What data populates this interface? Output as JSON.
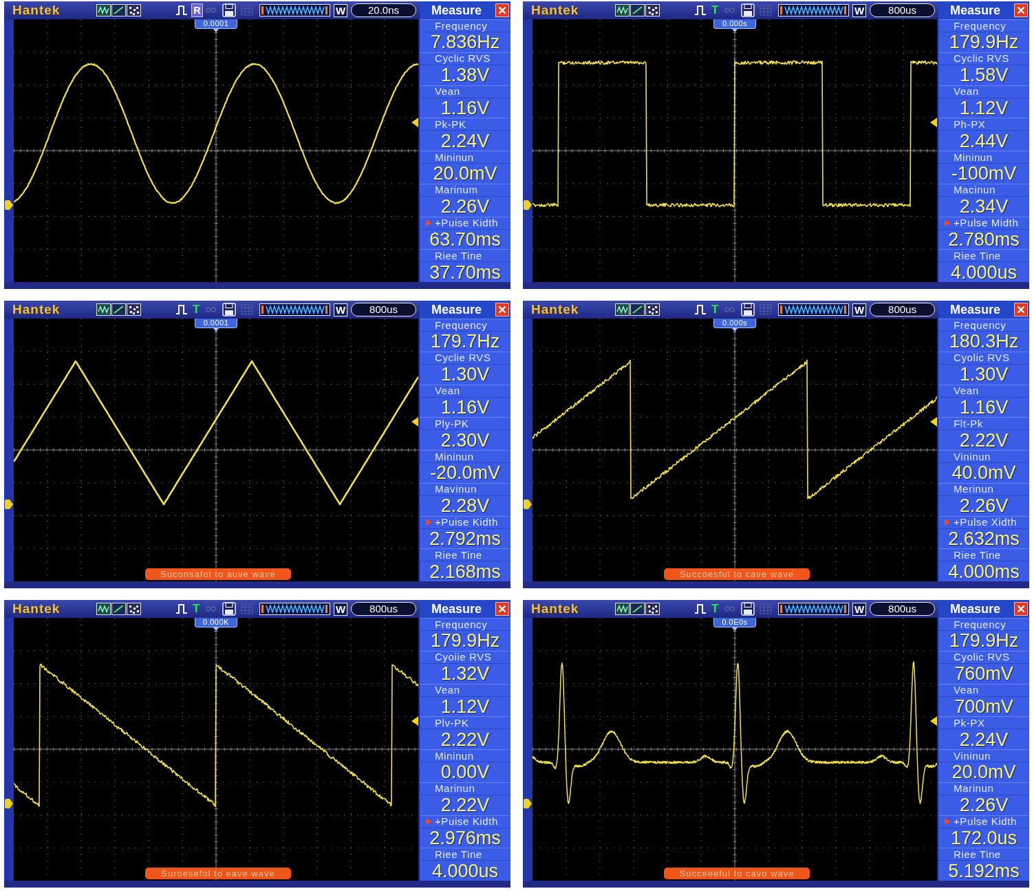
{
  "screens": [
    {
      "brand": "Hantek",
      "mode": {
        "label": "R",
        "kind": "boxed"
      },
      "memory_label": "W",
      "timebase": "20.0ns",
      "measure_title": "Measure",
      "trigger_time": "0.0001",
      "waveform": {
        "kind": "sine"
      },
      "measurements": [
        {
          "label": "Frequency",
          "value": "7.836Hz",
          "selected": false
        },
        {
          "label": "Cyclic RVS",
          "value": "1.38V",
          "selected": false
        },
        {
          "label": "Vean",
          "value": "1.16V",
          "selected": false
        },
        {
          "label": "Pk-PK",
          "value": "2.24V",
          "selected": false
        },
        {
          "label": "Mininun",
          "value": "20.0mV",
          "selected": false
        },
        {
          "label": "Marinum",
          "value": "2.26V",
          "selected": false
        },
        {
          "label": "+Puise Kidth",
          "value": "63.70ms",
          "selected": true
        },
        {
          "label": "Riee Tine",
          "value": "37.70ms",
          "selected": false
        }
      ]
    },
    {
      "brand": "Hantek",
      "mode": {
        "label": "T",
        "kind": "plain"
      },
      "memory_label": "W",
      "timebase": "800us",
      "measure_title": "Measure",
      "trigger_time": "0.000s",
      "waveform": {
        "kind": "square"
      },
      "measurements": [
        {
          "label": "Frequency",
          "value": "179.9Hz",
          "selected": false
        },
        {
          "label": "Cyclic RVS",
          "value": "1.58V",
          "selected": false
        },
        {
          "label": "Vean",
          "value": "1.12V",
          "selected": false
        },
        {
          "label": "Ph-PX",
          "value": "2.44V",
          "selected": false
        },
        {
          "label": "Mininun",
          "value": "-100mV",
          "selected": false
        },
        {
          "label": "Macinun",
          "value": "2.34V",
          "selected": false
        },
        {
          "label": "+Pulse Midth",
          "value": "2.780ms",
          "selected": true
        },
        {
          "label": "Riee Tine",
          "value": "4.000us",
          "selected": false
        }
      ]
    },
    {
      "brand": "Hantek",
      "mode": {
        "label": "T",
        "kind": "plain"
      },
      "memory_label": "W",
      "timebase": "800us",
      "measure_title": "Measure",
      "trigger_time": "0.0001",
      "waveform": {
        "kind": "triangle"
      },
      "measurements": [
        {
          "label": "Frequency",
          "value": "179.7Hz",
          "selected": false
        },
        {
          "label": "Cyclie RVS",
          "value": "1.30V",
          "selected": false
        },
        {
          "label": "Vean",
          "value": "1.16V",
          "selected": false
        },
        {
          "label": "Ply-PK",
          "value": "2.30V",
          "selected": false
        },
        {
          "label": "Mininun",
          "value": "-20.0mV",
          "selected": false
        },
        {
          "label": "Mavinun",
          "value": "2.28V",
          "selected": false
        },
        {
          "label": "+Puise Kidth",
          "value": "2.792ms",
          "selected": true
        },
        {
          "label": "Riee Tine",
          "value": "2.168ms",
          "selected": false
        }
      ],
      "status_message": "Suconsafol to auve wave"
    },
    {
      "brand": "Hantek",
      "mode": {
        "label": "T",
        "kind": "plain"
      },
      "memory_label": "W",
      "timebase": "800us",
      "measure_title": "Measure",
      "trigger_time": "0.000s",
      "waveform": {
        "kind": "ramp_up"
      },
      "measurements": [
        {
          "label": "Frequency",
          "value": "180.3Hz",
          "selected": false
        },
        {
          "label": "Cyolic RVS",
          "value": "1.30V",
          "selected": false
        },
        {
          "label": "Vean",
          "value": "1.16V",
          "selected": false
        },
        {
          "label": "Flt-Pk",
          "value": "2.22V",
          "selected": false
        },
        {
          "label": "Vininun",
          "value": "40.0mV",
          "selected": false
        },
        {
          "label": "Merinun",
          "value": "2.26V",
          "selected": false
        },
        {
          "label": "+Pulse Xidth",
          "value": "2.632ms",
          "selected": true
        },
        {
          "label": "Riee Tine",
          "value": "4.000ms",
          "selected": false
        }
      ],
      "status_message": "Succoesful to cave wave"
    },
    {
      "brand": "Hantek",
      "mode": {
        "label": "T",
        "kind": "plain"
      },
      "memory_label": "W",
      "timebase": "800us",
      "measure_title": "Measure",
      "trigger_time": "0.000K",
      "waveform": {
        "kind": "ramp_down"
      },
      "measurements": [
        {
          "label": "Frequency",
          "value": "179.9Hz",
          "selected": false
        },
        {
          "label": "Cyoiie RVS",
          "value": "1.32V",
          "selected": false
        },
        {
          "label": "Vean",
          "value": "1.12V",
          "selected": false
        },
        {
          "label": "Plv-PK",
          "value": "2.22V",
          "selected": false
        },
        {
          "label": "Mininun",
          "value": "0.00V",
          "selected": false
        },
        {
          "label": "Marinun",
          "value": "2.22V",
          "selected": false
        },
        {
          "label": "+Puise Kidth",
          "value": "2.976ms",
          "selected": true
        },
        {
          "label": "Riee Tine",
          "value": "4.000us",
          "selected": false
        }
      ],
      "status_message": "Suroesefol to eave wave"
    },
    {
      "brand": "Hantek",
      "mode": {
        "label": "T",
        "kind": "plain"
      },
      "memory_label": "W",
      "timebase": "800us",
      "measure_title": "Measure",
      "trigger_time": "0.0E0s",
      "waveform": {
        "kind": "ecg"
      },
      "measurements": [
        {
          "label": "Frequency",
          "value": "179.9Hz",
          "selected": false
        },
        {
          "label": "Cyolic RVS",
          "value": "760mV",
          "selected": false
        },
        {
          "label": "Vean",
          "value": "700mV",
          "selected": false
        },
        {
          "label": "Pk-PX",
          "value": "2.24V",
          "selected": false
        },
        {
          "label": "Vininun",
          "value": "20.0mV",
          "selected": false
        },
        {
          "label": "Marinun",
          "value": "2.26V",
          "selected": false
        },
        {
          "label": "+Pulse Kidth",
          "value": "172.0us",
          "selected": true
        },
        {
          "label": "Riee Tine",
          "value": "5.192ms",
          "selected": false
        }
      ],
      "status_message": "Succeeeful to cavo wave"
    }
  ]
}
